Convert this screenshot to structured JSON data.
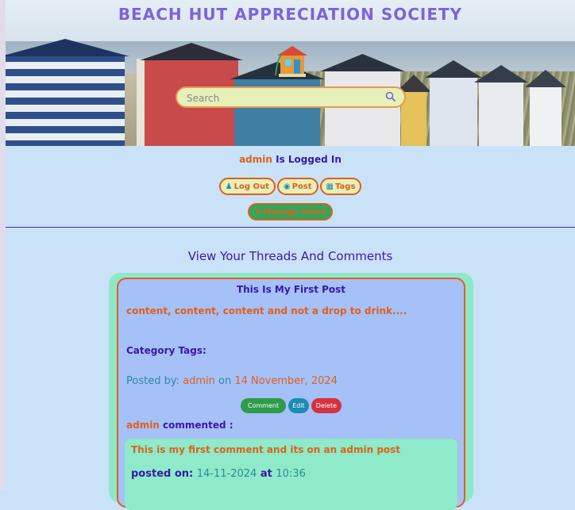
{
  "header": {
    "title": "BEACH HUT APPRECIATION SOCIETY",
    "search_placeholder": "Search"
  },
  "status": {
    "username": "admin",
    "logged_in_text": "Is Logged In"
  },
  "nav": {
    "logout_label": "Log Out",
    "post_label": "Post",
    "tags_label": "Tags",
    "manage_users_label": "Manage Users"
  },
  "main": {
    "heading": "View Your Threads And Comments",
    "post": {
      "title": "This Is My First Post",
      "content": "content, content, content and not a drop to drink....",
      "tags_label": "Category Tags:",
      "posted_by_label": "Posted by:",
      "author": "admin",
      "on_label": "on",
      "date": "14 November, 2024",
      "actions": {
        "comment": "Comment",
        "edit": "Edit",
        "delete": "Delete"
      },
      "comment": {
        "author": "admin",
        "commented_label": "commented :",
        "text": "This is my first comment and its on an admin post",
        "posted_on_label": "posted on:",
        "date": "14-11-2024",
        "at_label": "at",
        "time": "10:36"
      }
    }
  },
  "colors": {
    "background": "#c9e2f7",
    "accent_orange": "#e0601b",
    "accent_purple": "#3a18a8",
    "teal": "#2b8a9e",
    "card_green": "#8ee8c7",
    "card_blue": "#a6c0f8"
  }
}
